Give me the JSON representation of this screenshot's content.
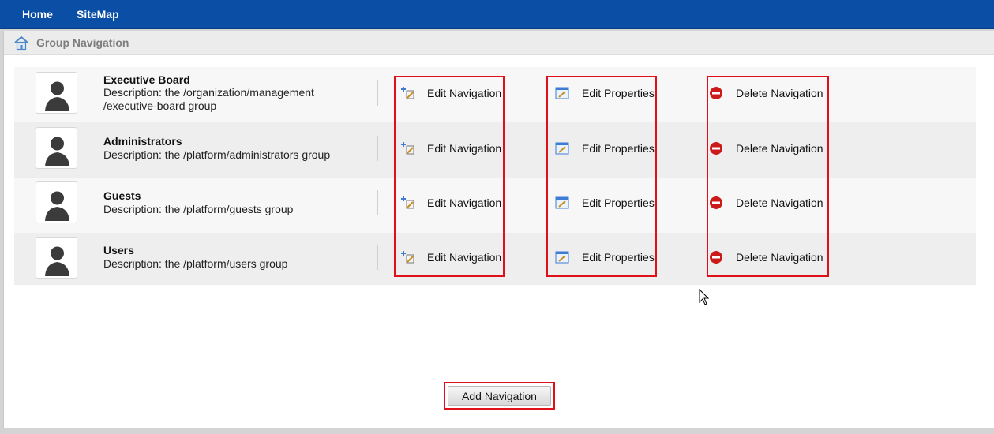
{
  "nav": {
    "home": "Home",
    "sitemap": "SiteMap"
  },
  "page": {
    "title": "Group Navigation"
  },
  "groups": [
    {
      "name": "Executive Board",
      "description": "Description: the /organization/management /executive-board group"
    },
    {
      "name": "Administrators",
      "description": "Description: the /platform/administrators group"
    },
    {
      "name": "Guests",
      "description": "Description: the /platform/guests group"
    },
    {
      "name": "Users",
      "description": "Description: the /platform/users group"
    }
  ],
  "actions": {
    "edit_navigation": "Edit Navigation",
    "edit_properties": "Edit Properties",
    "delete_navigation": "Delete Navigation"
  },
  "add_button": "Add Navigation",
  "colors": {
    "topbar": "#0b4ea6",
    "highlight": "#e0101a",
    "delete_icon": "#cc1a1a"
  }
}
